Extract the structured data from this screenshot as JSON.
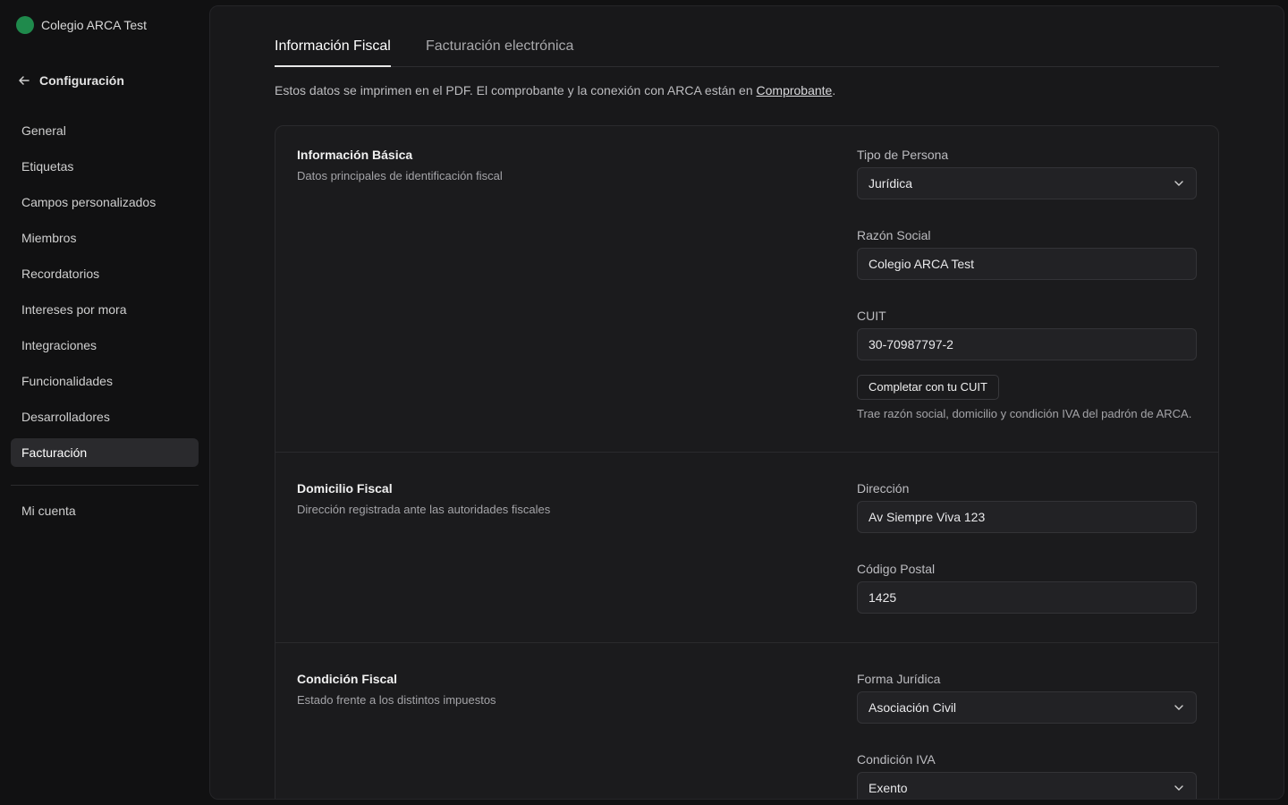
{
  "sidebar": {
    "org_name": "Colegio ARCA Test",
    "back_label": "Configuración",
    "items": [
      {
        "label": "General"
      },
      {
        "label": "Etiquetas"
      },
      {
        "label": "Campos personalizados"
      },
      {
        "label": "Miembros"
      },
      {
        "label": "Recordatorios"
      },
      {
        "label": "Intereses por mora"
      },
      {
        "label": "Integraciones"
      },
      {
        "label": "Funcionalidades"
      },
      {
        "label": "Desarrolladores"
      },
      {
        "label": "Facturación",
        "active": true
      }
    ],
    "account_label": "Mi cuenta"
  },
  "tabs": [
    {
      "label": "Información Fiscal",
      "active": true
    },
    {
      "label": "Facturación electrónica"
    }
  ],
  "intro": {
    "text": "Estos datos se imprimen en el PDF. El comprobante y la conexión con ARCA están en ",
    "link": "Comprobante",
    "end": "."
  },
  "sections": {
    "basic": {
      "title": "Información Básica",
      "subtitle": "Datos principales de identificación fiscal",
      "tipo_label": "Tipo de Persona",
      "tipo_value": "Jurídica",
      "razon_label": "Razón Social",
      "razon_value": "Colegio ARCA Test",
      "cuit_label": "CUIT",
      "cuit_value": "30-70987797-2",
      "cuit_button": "Completar con tu CUIT",
      "cuit_hint": "Trae razón social, domicilio y condición IVA del padrón de ARCA."
    },
    "domicilio": {
      "title": "Domicilio Fiscal",
      "subtitle": "Dirección registrada ante las autoridades fiscales",
      "direccion_label": "Dirección",
      "direccion_value": "Av Siempre Viva 123",
      "cp_label": "Código Postal",
      "cp_value": "1425"
    },
    "condicion": {
      "title": "Condición Fiscal",
      "subtitle": "Estado frente a los distintos impuestos",
      "forma_label": "Forma Jurídica",
      "forma_value": "Asociación Civil",
      "iva_label": "Condición IVA",
      "iva_value": "Exento"
    }
  },
  "colors": {
    "background": "#111112",
    "panel": "#18181a",
    "org_avatar": "#1f8a4c"
  }
}
